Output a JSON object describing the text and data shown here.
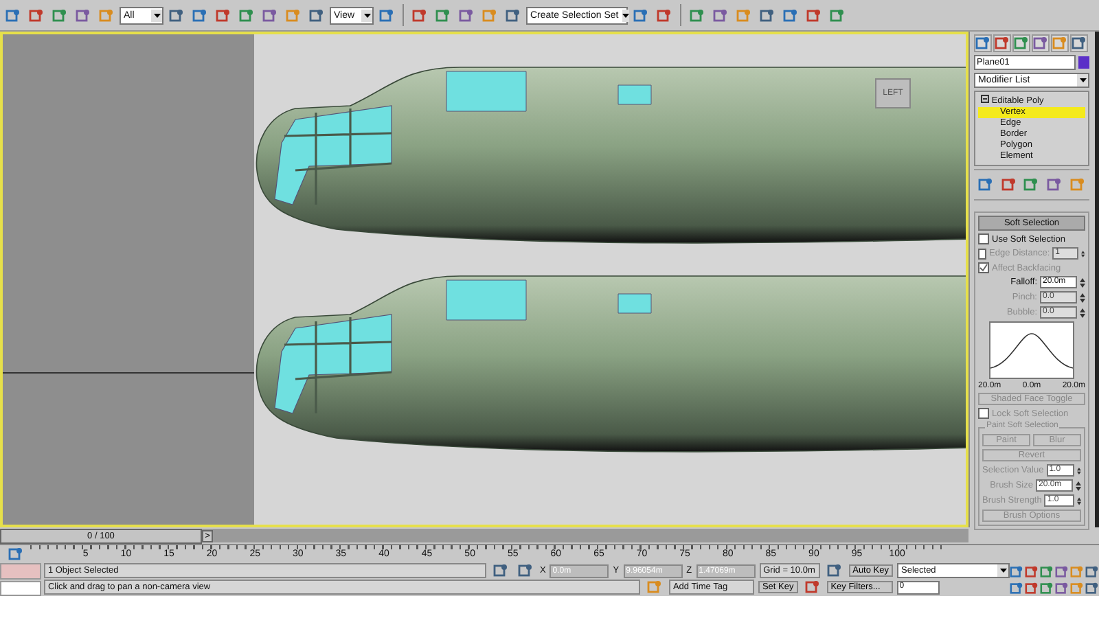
{
  "toolbar": {
    "selection_filter": "All",
    "reference_coord": "View",
    "named_selection": "Create Selection Set"
  },
  "viewport": {
    "viewcube_label": "LEFT"
  },
  "command_panel": {
    "object_name": "Plane01",
    "modifier_list": "Modifier List",
    "stack": [
      {
        "label": "Editable Poly",
        "expanded": true,
        "children": [
          {
            "label": "Vertex",
            "selected": true
          },
          {
            "label": "Edge",
            "selected": false
          },
          {
            "label": "Border",
            "selected": false
          },
          {
            "label": "Polygon",
            "selected": false
          },
          {
            "label": "Element",
            "selected": false
          }
        ]
      }
    ],
    "soft_selection": {
      "title": "Soft Selection",
      "use_soft_selection": {
        "label": "Use Soft Selection",
        "checked": false,
        "disabled": false
      },
      "edge_distance": {
        "label": "Edge Distance:",
        "checked": false,
        "disabled": true,
        "value": "1"
      },
      "affect_backfacing": {
        "label": "Affect Backfacing",
        "checked": true,
        "disabled": true
      },
      "spinners": [
        {
          "label": "Falloff:",
          "value": "20.0m",
          "disabled": false
        },
        {
          "label": "Pinch:",
          "value": "0.0",
          "disabled": true
        },
        {
          "label": "Bubble:",
          "value": "0.0",
          "disabled": true
        }
      ],
      "curve_labels": [
        "20.0m",
        "0.0m",
        "20.0m"
      ],
      "shaded_face_toggle": "Shaded Face Toggle",
      "lock_soft_selection": {
        "label": "Lock Soft Selection",
        "checked": false,
        "disabled": true
      },
      "paint_group": {
        "title": "Paint Soft Selection",
        "buttons": [
          "Paint",
          "Blur"
        ],
        "revert": "Revert",
        "spinners": [
          {
            "label": "Selection Value",
            "value": "1.0"
          },
          {
            "label": "Brush Size",
            "value": "20.0m"
          },
          {
            "label": "Brush Strength",
            "value": "1.0"
          }
        ],
        "options": "Brush Options"
      }
    }
  },
  "timeline": {
    "slider": "0 / 100",
    "next": ">",
    "ticks": [
      "5",
      "10",
      "15",
      "20",
      "25",
      "30",
      "35",
      "40",
      "45",
      "50",
      "55",
      "60",
      "65",
      "70",
      "75",
      "80",
      "85",
      "90",
      "95",
      "100"
    ]
  },
  "status": {
    "selection": "1 Object Selected",
    "prompt": "Click and drag to pan a non-camera view",
    "x": "0.0m",
    "y": "9.96054m",
    "z": "1.47069m",
    "x_label": "X",
    "y_label": "Y",
    "z_label": "Z",
    "grid": "Grid = 10.0m",
    "time_tag": "Add Time Tag",
    "auto_key": "Auto Key",
    "key_mode": "Selected",
    "set_key": "Set Key",
    "key_filters": "Key Filters...",
    "frame": "0"
  }
}
